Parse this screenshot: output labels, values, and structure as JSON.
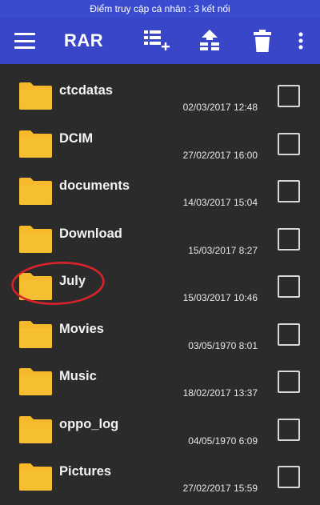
{
  "status_bar": {
    "text": "Điểm truy cập cá nhân : 3 kết nối"
  },
  "toolbar": {
    "title": "RAR",
    "icons": [
      "menu-icon",
      "add-archive-icon",
      "extract-up-icon",
      "trash-icon",
      "more-vert-icon"
    ]
  },
  "colors": {
    "toolbar": "#3a46c8",
    "background": "#2b2b2b",
    "folder": "#f5b92b",
    "annotation": "#d9232a"
  },
  "files": [
    {
      "name": "ctcdatas",
      "date": "02/03/2017 12:48"
    },
    {
      "name": "DCIM",
      "date": "27/02/2017 16:00"
    },
    {
      "name": "documents",
      "date": "14/03/2017 15:04"
    },
    {
      "name": "Download",
      "date": "15/03/2017 8:27"
    },
    {
      "name": "July",
      "date": "15/03/2017 10:46"
    },
    {
      "name": "Movies",
      "date": "03/05/1970 8:01"
    },
    {
      "name": "Music",
      "date": "18/02/2017 13:37"
    },
    {
      "name": "oppo_log",
      "date": "04/05/1970 6:09"
    },
    {
      "name": "Pictures",
      "date": "27/02/2017 15:59"
    }
  ]
}
